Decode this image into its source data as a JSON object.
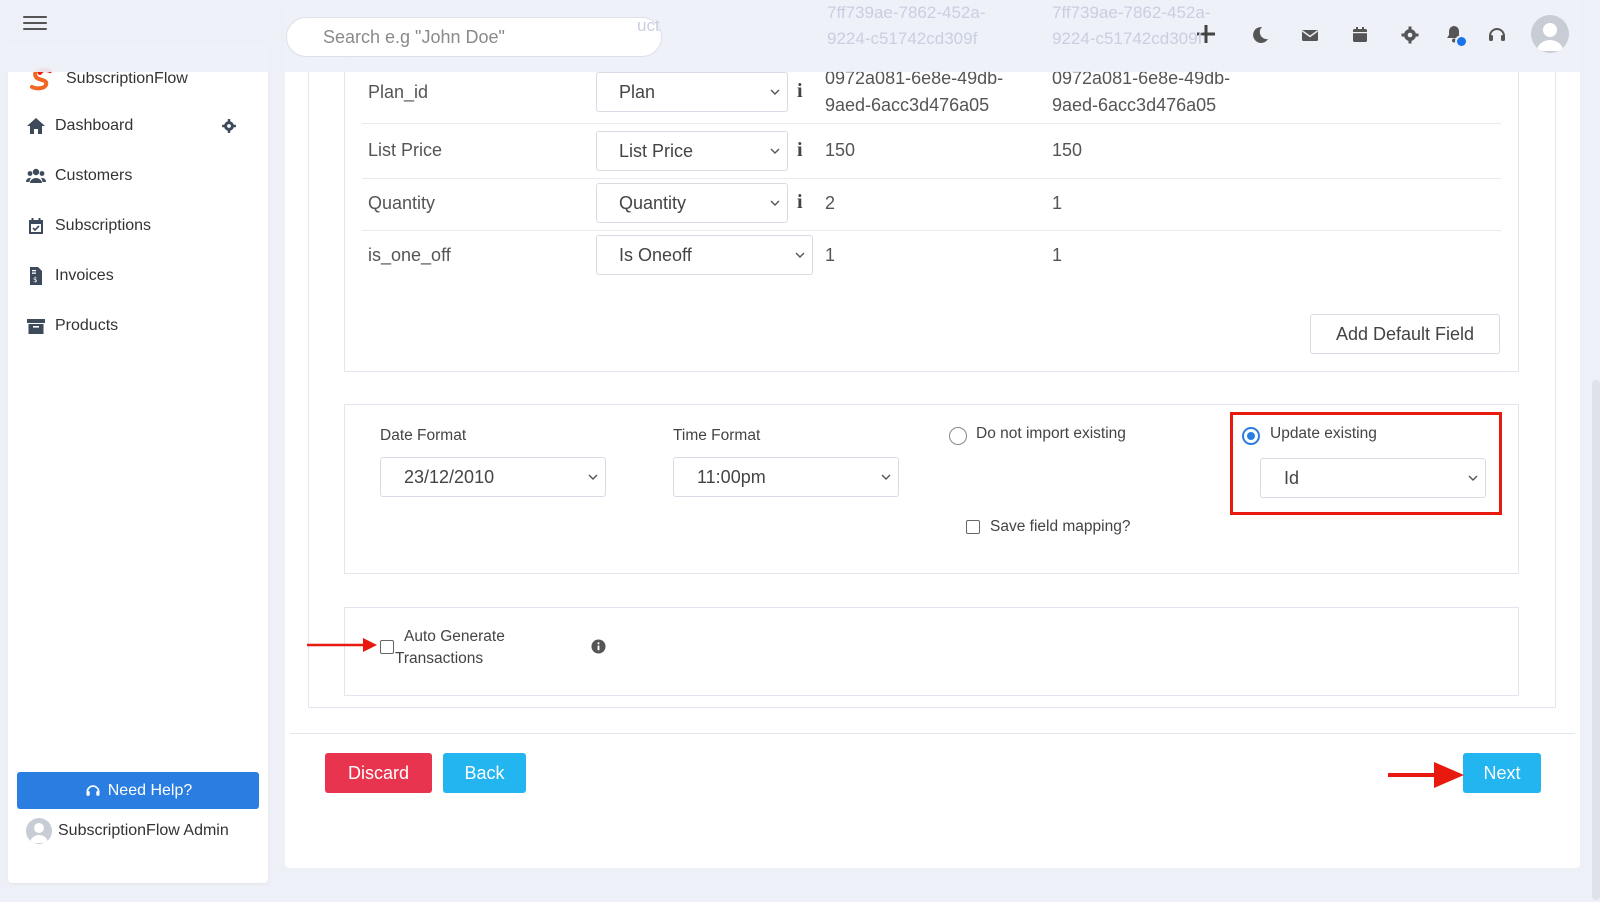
{
  "topbar": {
    "search_placeholder": "Search e.g \"John Doe\"",
    "ghost_text": [
      "uct",
      "7ff739ae-7862-452a-",
      "9224-c51742cd309f",
      "7ff739ae-7862-452a-",
      "9224-c51742cd309f"
    ]
  },
  "sidebar": {
    "brand": "SubscriptionFlow",
    "items": [
      {
        "label": "Dashboard",
        "icon": "home-icon"
      },
      {
        "label": "Customers",
        "icon": "users-icon"
      },
      {
        "label": "Subscriptions",
        "icon": "calendar-check-icon"
      },
      {
        "label": "Invoices",
        "icon": "invoice-icon"
      },
      {
        "label": "Products",
        "icon": "archive-icon"
      }
    ],
    "help_label": "Need Help?",
    "admin_label": "SubscriptionFlow Admin"
  },
  "mapping": {
    "rows": [
      {
        "field": "Plan_id",
        "select": "Plan",
        "value1": "0972a081-6e8e-49db-\n9aed-6acc3d476a05",
        "value1_a": "0972a081-6e8e-49db-",
        "value1_b": "9aed-6acc3d476a05",
        "value2_a": "0972a081-6e8e-49db-",
        "value2_b": "9aed-6acc3d476a05"
      },
      {
        "field": "List Price",
        "select": "List Price",
        "value1": "150",
        "value2": "150"
      },
      {
        "field": "Quantity",
        "select": "Quantity",
        "value1": "2",
        "value2": "1"
      },
      {
        "field": "is_one_off",
        "select": "Is Oneoff",
        "value1": "1",
        "value2": "1"
      }
    ],
    "add_default_label": "Add Default Field"
  },
  "options": {
    "date_format_label": "Date Format",
    "date_format_value": "23/12/2010",
    "time_format_label": "Time Format",
    "time_format_value": "11:00pm",
    "do_not_import_label": "Do not import existing",
    "update_existing_label": "Update existing",
    "update_key_value": "Id",
    "save_mapping_label": "Save field mapping?"
  },
  "auto_generate": {
    "label_line1": "Auto Generate",
    "label_line2": "Transactions"
  },
  "actions": {
    "discard_label": "Discard",
    "back_label": "Back",
    "next_label": "Next"
  },
  "colors": {
    "primary": "#2a7de1",
    "discard": "#e8344e",
    "accent_cyan": "#22b5f0",
    "annotation_red": "#e8190f"
  }
}
